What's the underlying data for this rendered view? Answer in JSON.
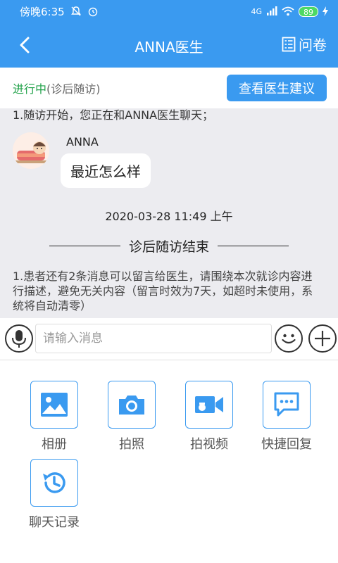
{
  "statusbar": {
    "time": "傍晚6:35",
    "network": "4G",
    "battery": "89"
  },
  "header": {
    "back_icon": "chevron-left-icon",
    "title": "ANNA医生",
    "questionnaire_label": "问卷",
    "questionnaire_icon": "document-list-icon"
  },
  "status": {
    "state": "进行中",
    "type": "(诊后随访)",
    "advice_button": "查看医生建议"
  },
  "chat": {
    "system_top": "1.随访开始，您正在和ANNA医生聊天；",
    "sender_name": "ANNA",
    "message": "最近怎么样",
    "timestamp": "2020-03-28 11:49 上午",
    "divider_label": "诊后随访结束",
    "system_bottom": "1.患者还有2条消息可以留言给医生，请围绕本次就诊内容进行描述，避免无关内容（留言时效为7天，如超时未使用，系统将自动清零）"
  },
  "input": {
    "placeholder": "请输入消息"
  },
  "tools": [
    {
      "label": "相册",
      "icon": "image-icon"
    },
    {
      "label": "拍照",
      "icon": "camera-icon"
    },
    {
      "label": "拍视频",
      "icon": "video-camera-icon"
    },
    {
      "label": "快捷回复",
      "icon": "chat-bubble-icon"
    },
    {
      "label": "聊天记录",
      "icon": "history-icon"
    }
  ],
  "colors": {
    "accent": "#3a9af0",
    "status_green": "#22a24a",
    "chat_bg": "#ececf0"
  }
}
